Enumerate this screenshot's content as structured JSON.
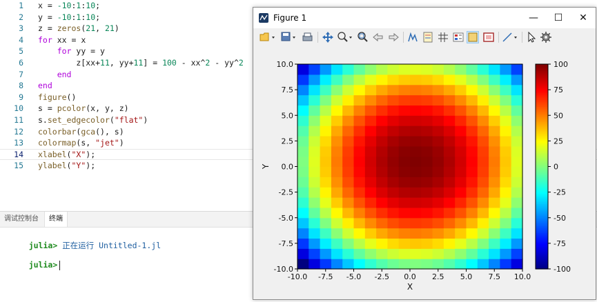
{
  "editor": {
    "lines": [
      {
        "n": "1",
        "tokens": [
          {
            "t": "x = ",
            "c": ""
          },
          {
            "t": "-10",
            "c": "num"
          },
          {
            "t": ":",
            "c": ""
          },
          {
            "t": "1",
            "c": "num"
          },
          {
            "t": ":",
            "c": ""
          },
          {
            "t": "10",
            "c": "num"
          },
          {
            "t": ";",
            "c": ""
          }
        ]
      },
      {
        "n": "2",
        "tokens": [
          {
            "t": "y = ",
            "c": ""
          },
          {
            "t": "-10",
            "c": "num"
          },
          {
            "t": ":",
            "c": ""
          },
          {
            "t": "1",
            "c": "num"
          },
          {
            "t": ":",
            "c": ""
          },
          {
            "t": "10",
            "c": "num"
          },
          {
            "t": ";",
            "c": ""
          }
        ]
      },
      {
        "n": "3",
        "tokens": [
          {
            "t": "z = ",
            "c": ""
          },
          {
            "t": "zeros",
            "c": "fn"
          },
          {
            "t": "(",
            "c": ""
          },
          {
            "t": "21",
            "c": "num"
          },
          {
            "t": ", ",
            "c": ""
          },
          {
            "t": "21",
            "c": "num"
          },
          {
            "t": ")",
            "c": ""
          }
        ]
      },
      {
        "n": "4",
        "tokens": [
          {
            "t": "for",
            "c": "kw"
          },
          {
            "t": " xx = x",
            "c": ""
          }
        ]
      },
      {
        "n": "5",
        "tokens": [
          {
            "t": "    ",
            "c": ""
          },
          {
            "t": "for",
            "c": "kw"
          },
          {
            "t": " yy = y",
            "c": ""
          }
        ]
      },
      {
        "n": "6",
        "tokens": [
          {
            "t": "        z[xx+",
            "c": ""
          },
          {
            "t": "11",
            "c": "num"
          },
          {
            "t": ", yy+",
            "c": ""
          },
          {
            "t": "11",
            "c": "num"
          },
          {
            "t": "] = ",
            "c": ""
          },
          {
            "t": "100",
            "c": "num"
          },
          {
            "t": " - xx^",
            "c": ""
          },
          {
            "t": "2",
            "c": "num"
          },
          {
            "t": " - yy^",
            "c": ""
          },
          {
            "t": "2",
            "c": "num"
          }
        ]
      },
      {
        "n": "7",
        "tokens": [
          {
            "t": "    ",
            "c": ""
          },
          {
            "t": "end",
            "c": "kw"
          }
        ]
      },
      {
        "n": "8",
        "tokens": [
          {
            "t": "end",
            "c": "kw"
          }
        ]
      },
      {
        "n": "9",
        "tokens": [
          {
            "t": "figure",
            "c": "fn"
          },
          {
            "t": "()",
            "c": ""
          }
        ]
      },
      {
        "n": "10",
        "tokens": [
          {
            "t": "s = ",
            "c": ""
          },
          {
            "t": "pcolor",
            "c": "fn"
          },
          {
            "t": "(x, y, z)",
            "c": ""
          }
        ]
      },
      {
        "n": "11",
        "tokens": [
          {
            "t": "s.",
            "c": ""
          },
          {
            "t": "set_edgecolor",
            "c": "fn"
          },
          {
            "t": "(",
            "c": ""
          },
          {
            "t": "\"flat\"",
            "c": "str"
          },
          {
            "t": ")",
            "c": ""
          }
        ]
      },
      {
        "n": "12",
        "tokens": [
          {
            "t": "colorbar",
            "c": "fn"
          },
          {
            "t": "(",
            "c": ""
          },
          {
            "t": "gca",
            "c": "fn"
          },
          {
            "t": "(), s)",
            "c": ""
          }
        ]
      },
      {
        "n": "13",
        "tokens": [
          {
            "t": "colormap",
            "c": "fn"
          },
          {
            "t": "(s, ",
            "c": ""
          },
          {
            "t": "\"jet\"",
            "c": "str"
          },
          {
            "t": ")",
            "c": ""
          }
        ]
      },
      {
        "n": "14",
        "tokens": [
          {
            "t": "xlabel",
            "c": "fn"
          },
          {
            "t": "(",
            "c": ""
          },
          {
            "t": "\"X\"",
            "c": "str"
          },
          {
            "t": ");",
            "c": ""
          }
        ],
        "active": true
      },
      {
        "n": "15",
        "tokens": [
          {
            "t": "ylabel",
            "c": "fn"
          },
          {
            "t": "(",
            "c": ""
          },
          {
            "t": "\"Y\"",
            "c": "str"
          },
          {
            "t": ");",
            "c": ""
          }
        ]
      }
    ]
  },
  "panel": {
    "tabs": [
      {
        "label": "调试控制台",
        "active": false
      },
      {
        "label": "终端",
        "active": true
      }
    ],
    "repl": {
      "prompt": "julia>",
      "running_text": "正在运行 Untitled-1.jl"
    }
  },
  "figure_window": {
    "title": "Figure 1",
    "buttons": {
      "minimize": "—",
      "maximize": "☐",
      "close": "✕"
    },
    "toolbar": [
      {
        "name": "open-icon"
      },
      {
        "name": "save-icon"
      },
      {
        "name": "print-icon"
      },
      {
        "name": "pan-icon"
      },
      {
        "name": "zoom-in-icon"
      },
      {
        "name": "zoom-fit-icon"
      },
      {
        "name": "back-arrow-icon"
      },
      {
        "name": "forward-arrow-icon"
      },
      {
        "name": "data-cursor-icon"
      },
      {
        "name": "legend-icon"
      },
      {
        "name": "grid-icon"
      },
      {
        "name": "colorbar-icon"
      },
      {
        "name": "axes-box-icon"
      },
      {
        "name": "frame-icon"
      },
      {
        "name": "line-tool-icon"
      },
      {
        "name": "select-cursor-icon"
      },
      {
        "name": "settings-icon"
      }
    ]
  },
  "chart_data": {
    "type": "heatmap",
    "title": "",
    "xlabel": "X",
    "ylabel": "Y",
    "x": [
      -10,
      -9,
      -8,
      -7,
      -6,
      -5,
      -4,
      -3,
      -2,
      -1,
      0,
      1,
      2,
      3,
      4,
      5,
      6,
      7,
      8,
      9,
      10
    ],
    "y": [
      -10,
      -9,
      -8,
      -7,
      -6,
      -5,
      -4,
      -3,
      -2,
      -1,
      0,
      1,
      2,
      3,
      4,
      5,
      6,
      7,
      8,
      9,
      10
    ],
    "z_formula": "z = 100 - x^2 - y^2",
    "colormap": "jet",
    "xlim": [
      -10,
      10
    ],
    "ylim": [
      -10,
      10
    ],
    "clim": [
      -100,
      100
    ],
    "xticks": [
      "-10.0",
      "-7.5",
      "-5.0",
      "-2.5",
      "0.0",
      "2.5",
      "5.0",
      "7.5",
      "10.0"
    ],
    "yticks": [
      "10.0",
      "7.5",
      "5.0",
      "2.5",
      "0.0",
      "-2.5",
      "-5.0",
      "-7.5",
      "-10.0"
    ],
    "colorbar_ticks": [
      "100",
      "75",
      "50",
      "25",
      "0",
      "-25",
      "-50",
      "-75",
      "-100"
    ],
    "grid": false,
    "colorbar_position": "right"
  }
}
